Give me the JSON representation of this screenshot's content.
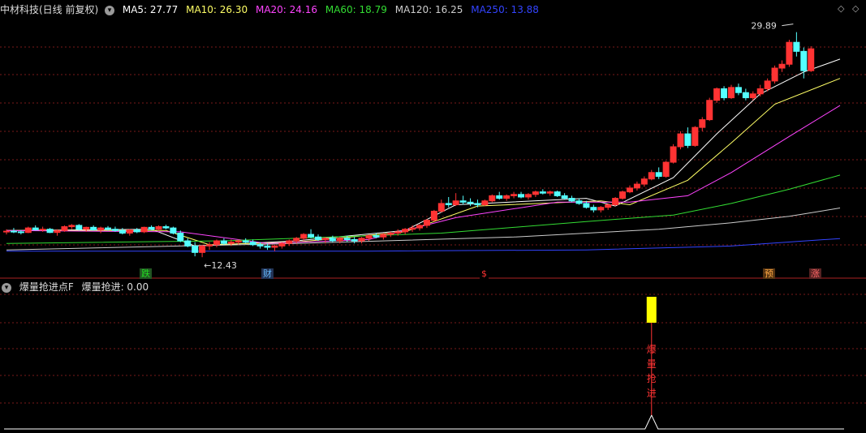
{
  "main_header": {
    "title": "中材科技(日线 前复权)",
    "ma": [
      {
        "label": "MA5: 27.77",
        "color": "#ffffff"
      },
      {
        "label": "MA10: 26.30",
        "color": "#ffff66"
      },
      {
        "label": "MA20: 24.16",
        "color": "#ff44ff"
      },
      {
        "label": "MA60: 18.79",
        "color": "#33dd33"
      },
      {
        "label": "MA120: 16.25",
        "color": "#cccccc"
      },
      {
        "label": "MA250: 13.88",
        "color": "#3344ff"
      }
    ]
  },
  "nav": {
    "prev_icon": "◇",
    "next_icon": "◇"
  },
  "annotations": {
    "high": "29.89",
    "low": "←12.43"
  },
  "markers": [
    {
      "text": "跌",
      "color": "#22dd22",
      "bg": "#225522",
      "pos": 0
    },
    {
      "text": "财",
      "color": "#66bbff",
      "bg": "#223355",
      "pos": 1
    },
    {
      "text": "$",
      "color": "#ff3333",
      "bg": "#000000",
      "pos": 2
    },
    {
      "text": "预",
      "color": "#ffaa44",
      "bg": "#553311",
      "pos": 3
    },
    {
      "text": "涨",
      "color": "#ff6666",
      "bg": "#552222",
      "pos": 4
    }
  ],
  "sub_header": {
    "indicator": "爆量抢进点F",
    "value_label": "爆量抢进: 0.00"
  },
  "signal": {
    "chars": [
      "爆",
      "量",
      "抢",
      "进"
    ],
    "bar_color": "#ffff00"
  },
  "chart_data": {
    "type": "candlestick",
    "symbol": "中材科技",
    "period": "日线",
    "price_range": [
      11.5,
      31
    ],
    "high_label": 29.89,
    "low_label": 12.43,
    "candles": [
      [
        14.4,
        14.6,
        14.2,
        14.45
      ],
      [
        14.45,
        14.7,
        14.3,
        14.4
      ],
      [
        14.4,
        14.55,
        14.2,
        14.35
      ],
      [
        14.35,
        14.8,
        14.3,
        14.7
      ],
      [
        14.7,
        14.9,
        14.5,
        14.55
      ],
      [
        14.55,
        14.8,
        14.4,
        14.6
      ],
      [
        14.6,
        14.7,
        14.3,
        14.35
      ],
      [
        14.35,
        14.6,
        14.1,
        14.5
      ],
      [
        14.5,
        14.9,
        14.4,
        14.8
      ],
      [
        14.8,
        15.0,
        14.6,
        14.9
      ],
      [
        14.9,
        15.0,
        14.5,
        14.6
      ],
      [
        14.6,
        14.8,
        14.4,
        14.75
      ],
      [
        14.75,
        14.9,
        14.5,
        14.55
      ],
      [
        14.55,
        14.8,
        14.3,
        14.7
      ],
      [
        14.7,
        14.85,
        14.5,
        14.6
      ],
      [
        14.6,
        14.8,
        14.4,
        14.5
      ],
      [
        14.5,
        14.7,
        14.2,
        14.3
      ],
      [
        14.3,
        14.6,
        14.1,
        14.55
      ],
      [
        14.55,
        14.7,
        14.3,
        14.4
      ],
      [
        14.4,
        14.8,
        14.3,
        14.75
      ],
      [
        14.75,
        14.9,
        14.5,
        14.6
      ],
      [
        14.6,
        14.9,
        14.5,
        14.8
      ],
      [
        14.8,
        14.95,
        14.6,
        14.7
      ],
      [
        14.7,
        14.8,
        14.2,
        14.3
      ],
      [
        14.3,
        14.5,
        13.6,
        13.7
      ],
      [
        13.7,
        13.9,
        13.2,
        13.3
      ],
      [
        13.3,
        13.6,
        12.5,
        12.8
      ],
      [
        12.8,
        13.4,
        12.43,
        13.3
      ],
      [
        13.3,
        13.6,
        13.0,
        13.4
      ],
      [
        13.4,
        13.8,
        13.2,
        13.7
      ],
      [
        13.7,
        13.9,
        13.4,
        13.5
      ],
      [
        13.5,
        13.8,
        13.3,
        13.6
      ],
      [
        13.6,
        13.8,
        13.4,
        13.7
      ],
      [
        13.7,
        13.9,
        13.5,
        13.6
      ],
      [
        13.6,
        13.8,
        13.3,
        13.4
      ],
      [
        13.4,
        13.6,
        13.1,
        13.3
      ],
      [
        13.3,
        13.5,
        13.0,
        13.2
      ],
      [
        13.2,
        13.4,
        12.9,
        13.3
      ],
      [
        13.3,
        13.6,
        13.1,
        13.5
      ],
      [
        13.5,
        13.8,
        13.3,
        13.7
      ],
      [
        13.7,
        14.0,
        13.5,
        13.9
      ],
      [
        13.9,
        14.3,
        13.7,
        14.2
      ],
      [
        14.2,
        14.6,
        13.9,
        14.0
      ],
      [
        14.0,
        14.2,
        13.7,
        13.8
      ],
      [
        13.8,
        14.0,
        13.5,
        13.9
      ],
      [
        13.9,
        14.1,
        13.6,
        13.7
      ],
      [
        13.7,
        14.0,
        13.5,
        13.9
      ],
      [
        13.9,
        14.1,
        13.6,
        13.8
      ],
      [
        13.8,
        14.0,
        13.5,
        13.7
      ],
      [
        13.7,
        14.0,
        13.5,
        13.9
      ],
      [
        13.9,
        14.2,
        13.7,
        14.1
      ],
      [
        14.1,
        14.3,
        13.9,
        14.0
      ],
      [
        14.0,
        14.3,
        13.8,
        14.2
      ],
      [
        14.2,
        14.4,
        14.0,
        14.3
      ],
      [
        14.3,
        14.6,
        14.1,
        14.4
      ],
      [
        14.4,
        14.7,
        14.2,
        14.6
      ],
      [
        14.6,
        14.9,
        14.4,
        14.7
      ],
      [
        14.7,
        15.0,
        14.5,
        14.9
      ],
      [
        14.9,
        15.4,
        14.7,
        15.3
      ],
      [
        15.3,
        16.1,
        15.2,
        16.0
      ],
      [
        16.0,
        16.9,
        15.9,
        16.6
      ],
      [
        16.6,
        17.1,
        16.3,
        16.5
      ],
      [
        16.5,
        17.4,
        16.4,
        16.8
      ],
      [
        16.8,
        17.2,
        16.5,
        16.7
      ],
      [
        16.7,
        17.0,
        16.4,
        16.6
      ],
      [
        16.6,
        16.9,
        16.3,
        16.5
      ],
      [
        16.5,
        16.9,
        16.4,
        16.8
      ],
      [
        16.8,
        17.3,
        16.7,
        17.2
      ],
      [
        17.2,
        17.5,
        16.9,
        17.0
      ],
      [
        17.0,
        17.3,
        16.8,
        17.2
      ],
      [
        17.2,
        17.5,
        17.0,
        17.3
      ],
      [
        17.3,
        17.5,
        17.0,
        17.1
      ],
      [
        17.1,
        17.4,
        16.9,
        17.3
      ],
      [
        17.3,
        17.6,
        17.1,
        17.5
      ],
      [
        17.5,
        17.7,
        17.3,
        17.4
      ],
      [
        17.4,
        17.6,
        17.2,
        17.5
      ],
      [
        17.5,
        17.6,
        17.1,
        17.2
      ],
      [
        17.2,
        17.4,
        16.9,
        17.0
      ],
      [
        17.0,
        17.2,
        16.7,
        16.8
      ],
      [
        16.8,
        17.0,
        16.5,
        16.6
      ],
      [
        16.6,
        16.8,
        16.2,
        16.3
      ],
      [
        16.3,
        16.5,
        15.9,
        16.1
      ],
      [
        16.1,
        16.4,
        15.9,
        16.3
      ],
      [
        16.3,
        16.6,
        16.1,
        16.5
      ],
      [
        16.5,
        17.1,
        16.4,
        17.0
      ],
      [
        17.0,
        17.6,
        16.9,
        17.5
      ],
      [
        17.5,
        18.0,
        17.4,
        17.8
      ],
      [
        17.8,
        18.3,
        17.6,
        18.1
      ],
      [
        18.1,
        18.7,
        17.9,
        18.5
      ],
      [
        18.5,
        19.2,
        18.4,
        19.0
      ],
      [
        19.0,
        19.4,
        18.5,
        18.7
      ],
      [
        18.7,
        19.9,
        18.6,
        19.8
      ],
      [
        19.8,
        21.2,
        19.7,
        21.0
      ],
      [
        21.0,
        22.2,
        20.8,
        22.0
      ],
      [
        22.0,
        22.5,
        20.9,
        21.1
      ],
      [
        21.1,
        22.6,
        21.0,
        22.5
      ],
      [
        22.5,
        23.3,
        22.2,
        23.1
      ],
      [
        23.1,
        24.8,
        23.0,
        24.6
      ],
      [
        24.6,
        25.6,
        24.4,
        25.5
      ],
      [
        25.5,
        25.7,
        24.6,
        24.8
      ],
      [
        24.8,
        25.8,
        24.7,
        25.6
      ],
      [
        25.6,
        25.9,
        25.0,
        25.2
      ],
      [
        25.2,
        25.5,
        24.6,
        24.8
      ],
      [
        24.8,
        25.3,
        24.6,
        25.1
      ],
      [
        25.1,
        25.8,
        24.9,
        25.5
      ],
      [
        25.5,
        26.3,
        25.3,
        26.1
      ],
      [
        26.1,
        27.3,
        25.9,
        27.1
      ],
      [
        27.1,
        27.7,
        26.8,
        27.4
      ],
      [
        27.4,
        29.3,
        27.2,
        29.1
      ],
      [
        29.1,
        29.89,
        28.0,
        28.4
      ],
      [
        28.4,
        28.7,
        26.3,
        26.9
      ],
      [
        26.9,
        28.8,
        26.8,
        28.6
      ]
    ],
    "series": [
      {
        "name": "MA5",
        "color": "#ffffff",
        "values": [
          [
            0,
            14.5
          ],
          [
            20,
            14.6
          ],
          [
            26,
            13.3
          ],
          [
            40,
            13.7
          ],
          [
            55,
            14.5
          ],
          [
            62,
            16.5
          ],
          [
            80,
            17.0
          ],
          [
            84,
            16.4
          ],
          [
            92,
            18.6
          ],
          [
            98,
            22.0
          ],
          [
            104,
            25.1
          ],
          [
            110,
            26.8
          ],
          [
            115,
            27.8
          ]
        ]
      },
      {
        "name": "MA10",
        "color": "#ffff66",
        "values": [
          [
            0,
            14.5
          ],
          [
            22,
            14.5
          ],
          [
            28,
            13.4
          ],
          [
            40,
            13.6
          ],
          [
            55,
            14.4
          ],
          [
            65,
            16.4
          ],
          [
            82,
            16.8
          ],
          [
            86,
            16.5
          ],
          [
            94,
            18.4
          ],
          [
            100,
            21.3
          ],
          [
            106,
            24.3
          ],
          [
            115,
            26.3
          ]
        ]
      },
      {
        "name": "MA20",
        "color": "#ff44ff",
        "values": [
          [
            0,
            14.5
          ],
          [
            24,
            14.4
          ],
          [
            36,
            13.5
          ],
          [
            50,
            13.8
          ],
          [
            62,
            15.5
          ],
          [
            76,
            16.7
          ],
          [
            86,
            16.7
          ],
          [
            94,
            17.2
          ],
          [
            100,
            19.0
          ],
          [
            108,
            21.8
          ],
          [
            115,
            24.2
          ]
        ]
      },
      {
        "name": "MA60",
        "color": "#33dd33",
        "values": [
          [
            0,
            13.5
          ],
          [
            30,
            13.7
          ],
          [
            60,
            14.3
          ],
          [
            80,
            15.2
          ],
          [
            92,
            15.7
          ],
          [
            100,
            16.6
          ],
          [
            108,
            17.7
          ],
          [
            115,
            18.8
          ]
        ]
      },
      {
        "name": "MA120",
        "color": "#cccccc",
        "values": [
          [
            0,
            13.0
          ],
          [
            40,
            13.5
          ],
          [
            70,
            14.0
          ],
          [
            90,
            14.6
          ],
          [
            100,
            15.1
          ],
          [
            108,
            15.6
          ],
          [
            115,
            16.25
          ]
        ]
      },
      {
        "name": "MA250",
        "color": "#3344ff",
        "values": [
          [
            0,
            12.9
          ],
          [
            50,
            12.9
          ],
          [
            80,
            13.0
          ],
          [
            100,
            13.3
          ],
          [
            115,
            13.88
          ]
        ]
      }
    ],
    "indicator": {
      "name": "爆量抢进",
      "value": 0.0,
      "signal_bar_index": 89
    }
  }
}
